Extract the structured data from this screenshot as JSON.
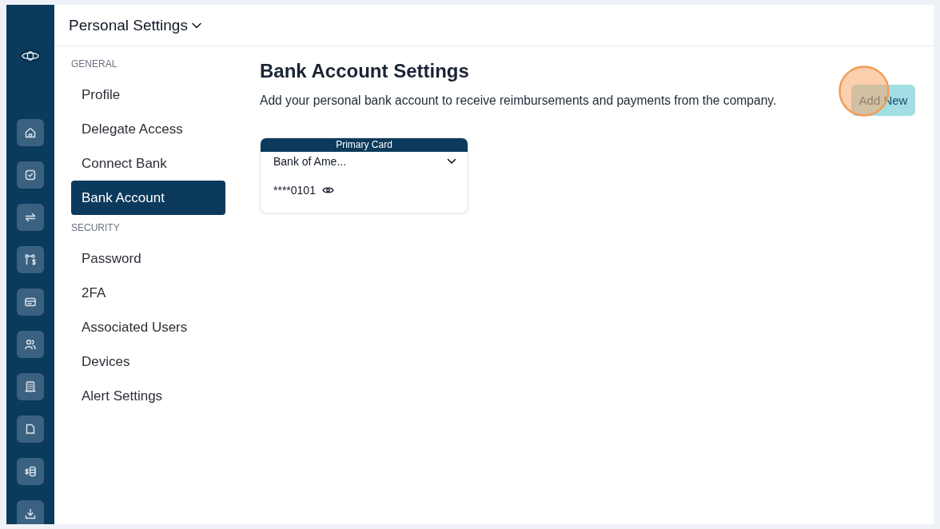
{
  "header": {
    "title": "Personal Settings"
  },
  "sidebar": {
    "sections": [
      {
        "heading": "GENERAL",
        "items": [
          {
            "label": "Profile",
            "selected": false
          },
          {
            "label": "Delegate Access",
            "selected": false
          },
          {
            "label": "Connect Bank",
            "selected": false
          },
          {
            "label": "Bank Account",
            "selected": true
          }
        ]
      },
      {
        "heading": "SECURITY",
        "items": [
          {
            "label": "Password",
            "selected": false
          },
          {
            "label": "2FA",
            "selected": false
          },
          {
            "label": "Associated Users",
            "selected": false
          },
          {
            "label": "Devices",
            "selected": false
          },
          {
            "label": "Alert Settings",
            "selected": false
          }
        ]
      }
    ]
  },
  "main": {
    "title": "Bank Account Settings",
    "description": "Add your personal bank account to receive reimbursements and payments from the company.",
    "add_button": "Add New",
    "accounts": [
      {
        "banner": "Primary Card",
        "bank": "Bank of Ame...",
        "number": "****0101"
      }
    ]
  }
}
